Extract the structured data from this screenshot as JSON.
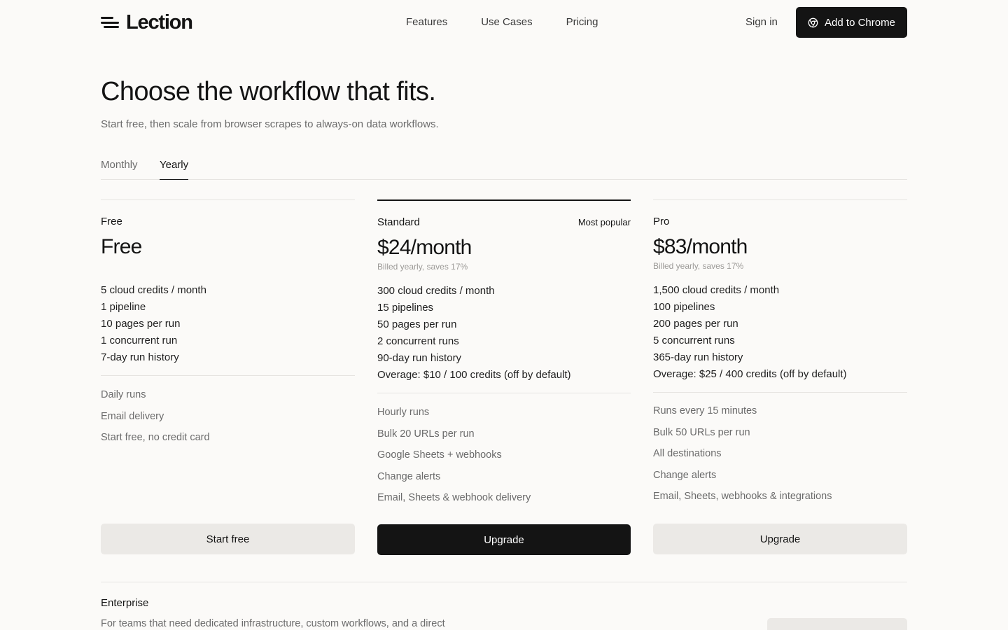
{
  "header": {
    "logo_text": "Lection",
    "nav": [
      "Features",
      "Use Cases",
      "Pricing"
    ],
    "signin": "Sign in",
    "cta": "Add to Chrome"
  },
  "hero": {
    "title": "Choose the workflow that fits.",
    "subtitle": "Start free, then scale from browser scrapes to always-on data workflows."
  },
  "billing_tabs": {
    "items": [
      "Monthly",
      "Yearly"
    ],
    "selected": "Yearly"
  },
  "plans": [
    {
      "name": "Free",
      "price": "Free",
      "billing_note": "",
      "limits": [
        "5 cloud credits / month",
        "1 pipeline",
        "10 pages per run",
        "1 concurrent run",
        "7-day run history"
      ],
      "features": [
        "Daily runs",
        "Email delivery",
        "Start free, no credit card"
      ],
      "cta": "Start free"
    },
    {
      "name": "Standard",
      "badge": "Most popular",
      "price": "$24/month",
      "billing_note": "Billed yearly, saves 17%",
      "limits": [
        "300 cloud credits / month",
        "15 pipelines",
        "50 pages per run",
        "2 concurrent runs",
        "90-day run history",
        "Overage: $10 / 100 credits (off by default)"
      ],
      "features": [
        "Hourly runs",
        "Bulk 20 URLs per run",
        "Google Sheets + webhooks",
        "Change alerts",
        "Email, Sheets & webhook delivery"
      ],
      "cta": "Upgrade"
    },
    {
      "name": "Pro",
      "price": "$83/month",
      "billing_note": "Billed yearly, saves 17%",
      "limits": [
        "1,500 cloud credits / month",
        "100 pipelines",
        "200 pages per run",
        "5 concurrent runs",
        "365-day run history",
        "Overage: $25 / 400 credits (off by default)"
      ],
      "features": [
        "Runs every 15 minutes",
        "Bulk 50 URLs per run",
        "All destinations",
        "Change alerts",
        "Email, Sheets, webhooks & integrations"
      ],
      "cta": "Upgrade"
    }
  ],
  "enterprise": {
    "title": "Enterprise",
    "description": "For teams that need dedicated infrastructure, custom workflows, and a direct"
  },
  "colors": {
    "background": "#fbfaf8",
    "primary": "#141414",
    "muted_text": "#6b6b6b",
    "light_button": "#ebe9e6",
    "border": "#e6e4e1"
  }
}
